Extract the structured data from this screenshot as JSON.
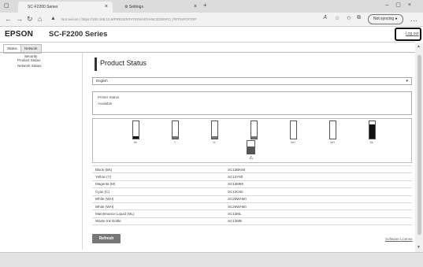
{
  "browser": {
    "tabs": [
      {
        "label": "SC-F2200 Series"
      },
      {
        "label": "Settings"
      }
    ],
    "url": "https://192.168.10.9/PRESENTATION/ADVANCED/INFO_PRTINFO/TOP",
    "url_prefix": "Not secure",
    "sync_label": "Not syncing"
  },
  "header": {
    "brand": "EPSON",
    "model": "SC-F2200 Series",
    "logout": "Log out"
  },
  "subtabs": [
    "Status",
    "Network Security"
  ],
  "sidebar": {
    "items": [
      "Product Status",
      "Network Status"
    ]
  },
  "main": {
    "title": "Product Status",
    "language": "English",
    "printer_status_legend": "Printer Status",
    "printer_status_value": "Available",
    "inks": [
      {
        "label": "BK",
        "level": 0.15,
        "color": "#111111"
      },
      {
        "label": "Y",
        "level": 0.15,
        "color": "#777777"
      },
      {
        "label": "M",
        "level": 0.15,
        "color": "#777777"
      },
      {
        "label": "C",
        "level": 0.15,
        "color": "#777777"
      },
      {
        "label": "WH",
        "level": 0.0,
        "color": "#777777"
      },
      {
        "label": "WH",
        "level": 0.0,
        "color": "#777777"
      },
      {
        "label": "ML",
        "level": 0.8,
        "color": "#111111"
      }
    ],
    "maintenance_box_level": 0.55,
    "table": [
      [
        "Black (BK)",
        "SC13BK60"
      ],
      [
        "Yellow (Y)",
        "SC13Y60"
      ],
      [
        "Magenta (M)",
        "SC13M60"
      ],
      [
        "Cyan (C)",
        "SC13C60"
      ],
      [
        "White (WH)",
        "SC26WH60"
      ],
      [
        "White (WH)",
        "SC26WH60"
      ],
      [
        "Maintenance Liquid (ML)",
        "SC13ML"
      ],
      [
        "Waste Ink Bottle",
        "SC13MB"
      ]
    ],
    "refresh_label": "Refresh",
    "license_label": "Software License"
  }
}
